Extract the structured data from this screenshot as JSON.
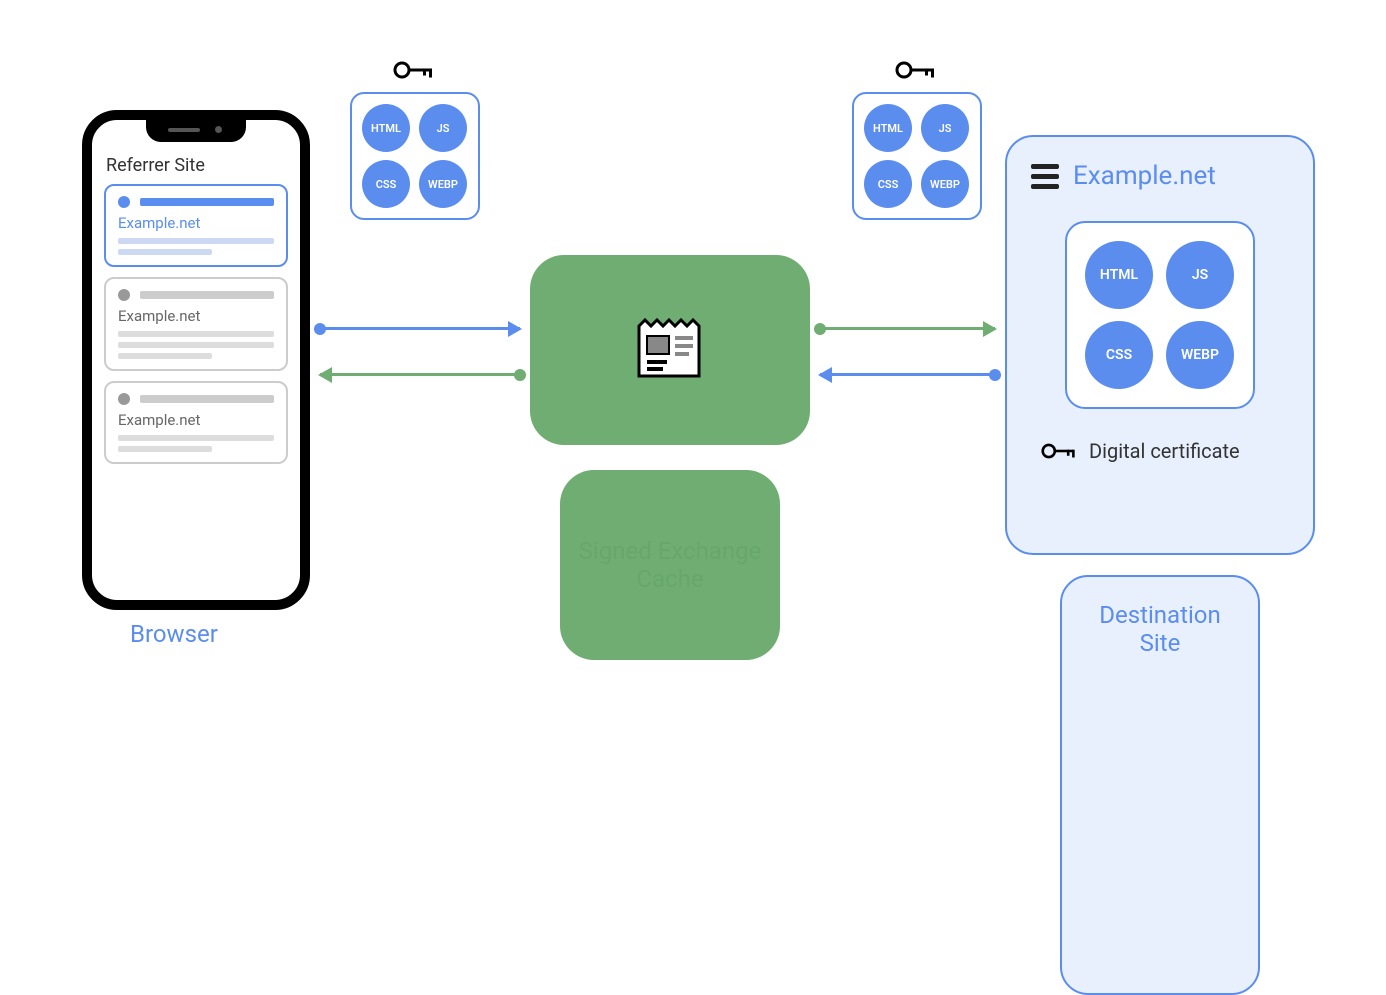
{
  "labels": {
    "browser": "Browser",
    "cache": "Signed Exchange Cache",
    "destination": "Destination Site"
  },
  "referrer": {
    "title": "Referrer Site",
    "site_name": "Example.net"
  },
  "assets": {
    "chip1": "HTML",
    "chip2": "JS",
    "chip3": "CSS",
    "chip4": "WEBP"
  },
  "destination": {
    "title": "Example.net",
    "certificate": "Digital certificate"
  },
  "colors": {
    "blue": "#5B8DEF",
    "green": "#6FAD73",
    "lightblue": "#E8F0FD"
  }
}
